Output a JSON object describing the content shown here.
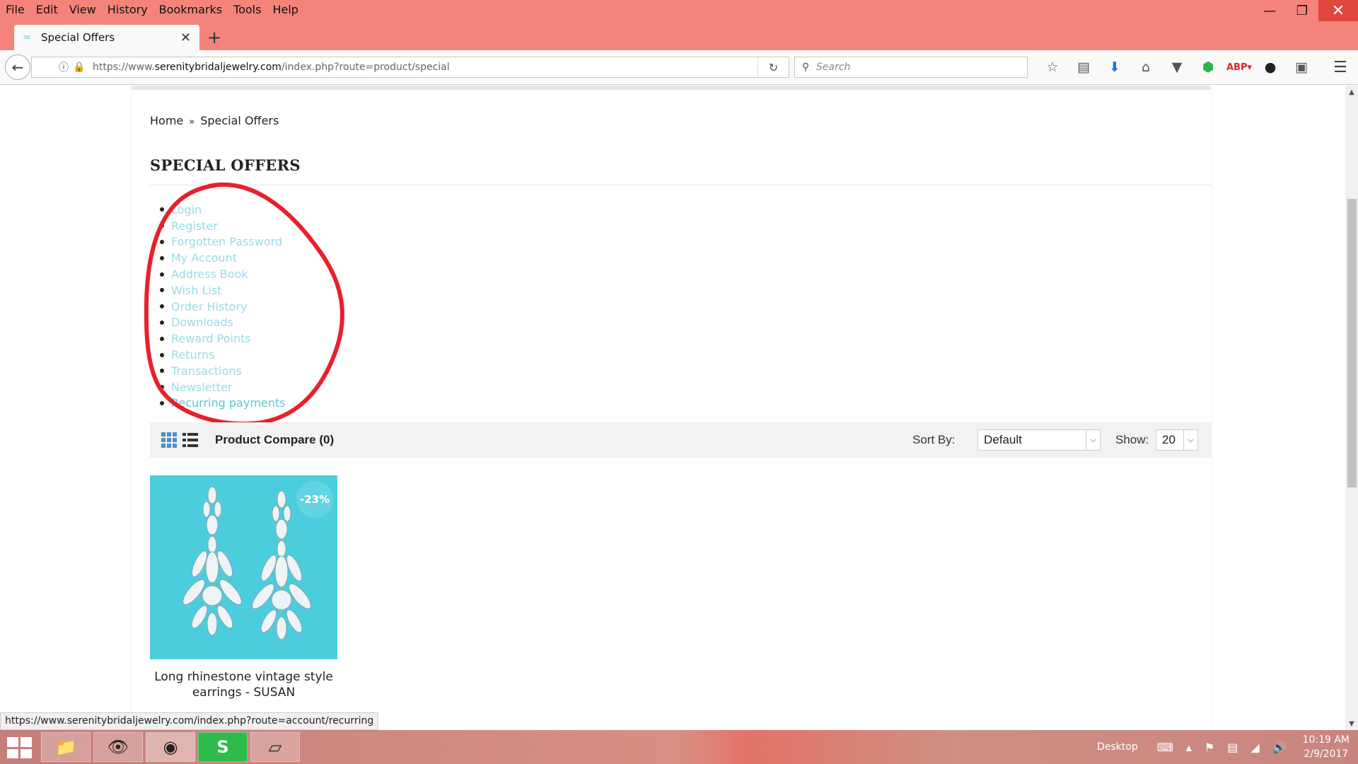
{
  "browser": {
    "menu": [
      "File",
      "Edit",
      "View",
      "History",
      "Bookmarks",
      "Tools",
      "Help"
    ],
    "tab_title": "Special Offers",
    "url_prefix": "https://www.",
    "url_domain": "serenitybridaljewelry.com",
    "url_path": "/index.php?route=product/special",
    "search_placeholder": "Search",
    "status_url": "https://www.serenitybridaljewelry.com/index.php?route=account/recurring"
  },
  "page": {
    "breadcrumb": [
      "Home",
      "Special Offers"
    ],
    "breadcrumb_sep": "»",
    "title": "SPECIAL OFFERS",
    "account_links": [
      "Login",
      "Register",
      "Forgotten Password",
      "My Account",
      "Address Book",
      "Wish List",
      "Order History",
      "Downloads",
      "Reward Points",
      "Returns",
      "Transactions",
      "Newsletter",
      "Recurring payments"
    ],
    "toolbar": {
      "compare": "Product Compare (0)",
      "sort_label": "Sort By:",
      "sort_value": "Default",
      "show_label": "Show:",
      "show_value": "20"
    },
    "product": {
      "discount": "-23%",
      "name": "Long rhinestone vintage style earrings - SUSAN"
    }
  },
  "taskbar": {
    "desktop_label": "Desktop",
    "time": "10:19 AM",
    "date": "2/9/2017"
  },
  "colors": {
    "titlebar": "#f4837b",
    "link": "#99dbe8",
    "annotation": "#e8202a",
    "product_bg": "#4ccdde"
  }
}
